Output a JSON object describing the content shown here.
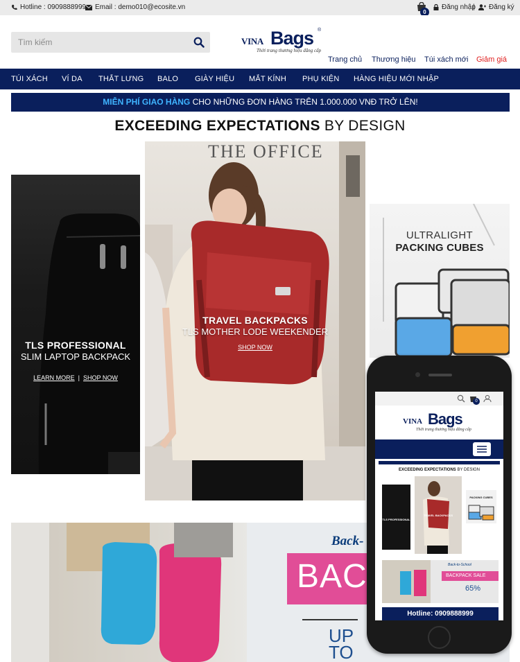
{
  "topbar": {
    "hotline": "Hotline : 0909888999",
    "email": "Email : demo010@ecosite.vn",
    "cart_count": "0",
    "login": "Đăng nhập",
    "separator": "|",
    "register": "Đăng ký"
  },
  "header": {
    "search_placeholder": "Tìm kiếm",
    "logo_vina": "VINA",
    "logo_bags": "Bags",
    "logo_tagline": "Thời trang thương hiệu đẳng cấp",
    "nav": [
      "Trang chủ",
      "Thương hiệu",
      "Túi xách mới",
      "Giảm giá"
    ]
  },
  "mainnav": [
    "TÚI XÁCH",
    "VÍ DA",
    "THẮT LƯNG",
    "BALO",
    "GIÀY HIỆU",
    "MẮT KÍNH",
    "PHỤ KIỆN",
    "HÀNG HIỆU MỚI NHẬP"
  ],
  "promo": {
    "highlight": "MIỄN PHÍ GIAO HÀNG",
    "rest": " CHO NHỮNG ĐƠN HÀNG TRÊN 1.000.000 VNĐ TRỞ LÊN!"
  },
  "headline": {
    "bold": "EXCEEDING EXPECTATIONS",
    "light": " BY DESIGN"
  },
  "left_banner": {
    "title": "TLS PROFESSIONAL",
    "subtitle": "SLIM LAPTOP BACKPACK",
    "learn_more": "LEARN MORE",
    "sep": "|",
    "shop_now": "SHOP NOW"
  },
  "mid_banner": {
    "sign": "THE OFFICE",
    "title": "TRAVEL BACKPACKS",
    "subtitle": "TLS MOTHER LODE WEEKENDER",
    "shop_now": "SHOP NOW"
  },
  "right_banner": {
    "title_light": "ULTRALIGHT",
    "title_bold": "PACKING CUBES"
  },
  "bottom_banner": {
    "script": "Back-",
    "sale": "BACKPA",
    "up": "UP",
    "to": "TO"
  },
  "phone": {
    "cart_count": "0",
    "logo_vina": "VINA",
    "logo_bags": "Bags",
    "logo_tagline": "Thời trang thương hiệu đẳng cấp",
    "headline_bold": "EXCEEDING EXPECTATIONS",
    "headline_light": " BY DESIGN",
    "mini_left": "TLS PROFESSIONAL",
    "mini_mid": "TRAVEL BACKPACKS",
    "mini_right": "PACKING CUBES",
    "mini_script": "Back-to-School",
    "mini_sale": "BACKPACK SALE",
    "mini_pct": "65%",
    "hotline": "Hotline: 0909888999"
  },
  "colors": {
    "navy": "#0a1f5c",
    "accent_red": "#e02020",
    "promo_blue": "#3fb4ff"
  }
}
